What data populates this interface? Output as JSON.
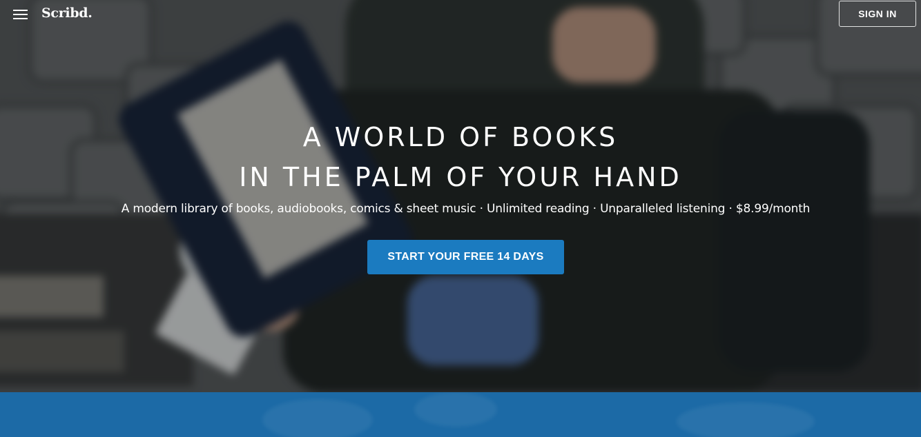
{
  "header": {
    "menu_icon": "hamburger-menu-icon",
    "logo_text": "Scribd.",
    "sign_in_label": "SIGN IN"
  },
  "hero": {
    "headline_line1": "A WORLD OF BOOKS",
    "headline_line2": "IN THE PALM OF YOUR HAND",
    "tagline": "A modern library of books, audiobooks, comics & sheet music · Unlimited reading · Unparalleled listening · $8.99/month",
    "cta_label": "START YOUR FREE 14 DAYS"
  },
  "colors": {
    "cta_background": "#1b7bc0",
    "band_background": "#1c6aa6",
    "text": "#ffffff"
  }
}
